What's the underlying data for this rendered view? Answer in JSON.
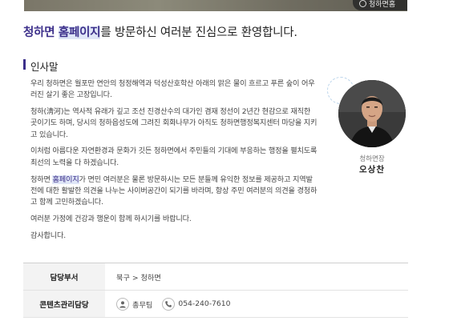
{
  "top_badge": {
    "label": "청하면홈"
  },
  "welcome": {
    "place": "청하면",
    "homepage": "홈페이지",
    "rest": "를 방문하신 여러분 진심으로 환영합니다."
  },
  "greeting": {
    "heading": "인사말",
    "p1": "우리 청하면은 월포만 연안의 청정해역과 덕성산호학산 아래의 맑은 물이 흐르고 푸른 숲이 어우러진 살기 좋은 고장입니다.",
    "p2": "청하(淸河)는 역사적 유래가 깊고 조선 진경산수의 대가인 겸재 정선이 2년간 현감으로 재직한 곳이기도 하며, 당시의 청하읍성도에 그려진 회화나무가 아직도 청하면행정복지센터 마당을 지키고 있습니다.",
    "p3": "이처럼 아름다운 자연환경과 문화가 깃든 청하면에서 주민들의 기대에 부응하는 행정을 펼치도록 최선의 노력을 다 하겠습니다.",
    "p4_a": "청하면 ",
    "p4_hl": "홈페이지",
    "p4_b": "가 면민 여러분은 물론 방문하시는 모든 분들께 유익한 정보를 제공하고 지역발전에 대한 활발한 의견을 나누는 사이버공간이 되기를 바라며, 항상 주민 여러분의 의견을 경청하고 함께 고민하겠습니다.",
    "p5": "여러분 가정에 건강과 행운이 함께 하시기를 바랍니다.",
    "p6": "감사합니다."
  },
  "profile": {
    "role": "청하면장",
    "name": "오상찬"
  },
  "info": {
    "dept_label": "담당부서",
    "dept_value": "북구 > 청하면",
    "manager_label": "콘텐츠관리담당",
    "manager_name": "총무팀",
    "manager_phone": "054-240-7610"
  },
  "icons": [
    "person-icon",
    "phone-icon"
  ]
}
